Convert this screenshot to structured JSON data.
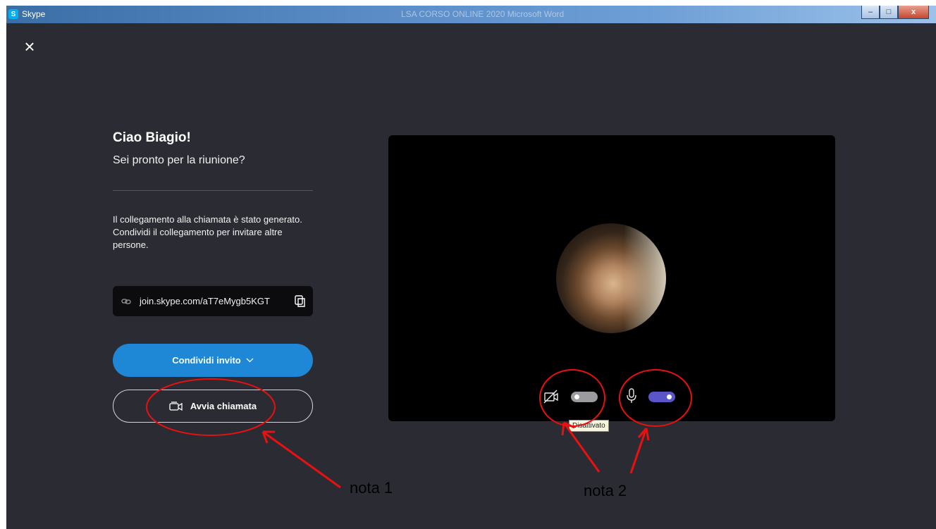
{
  "window": {
    "app_title": "Skype",
    "app_icon_letter": "S",
    "faded_title": "LSA  CORSO ONLINE 2020  Microsoft Word",
    "controls": [
      "–",
      "□",
      "x"
    ]
  },
  "main": {
    "greeting": "Ciao Biagio!",
    "subtitle": "Sei pronto per la riunione?",
    "info_line1": "Il collegamento alla chiamata è stato generato.",
    "info_line2": "Condividi il collegamento per invitare altre persone.",
    "link": "join.skype.com/aT7eMygb5KGT",
    "share_label": "Condividi invito",
    "call_label": "Avvia chiamata"
  },
  "preview": {
    "camera_state": "off",
    "mic_state": "on",
    "tooltip": "Disattivato"
  },
  "annotations": {
    "note1": "nota 1",
    "note2": "nota 2",
    "color": "#e81010"
  },
  "colors": {
    "background": "#2b2c33",
    "share_button": "#1e87d6",
    "mic_toggle": "#5b55c9",
    "cam_toggle": "#9b9ba0"
  }
}
